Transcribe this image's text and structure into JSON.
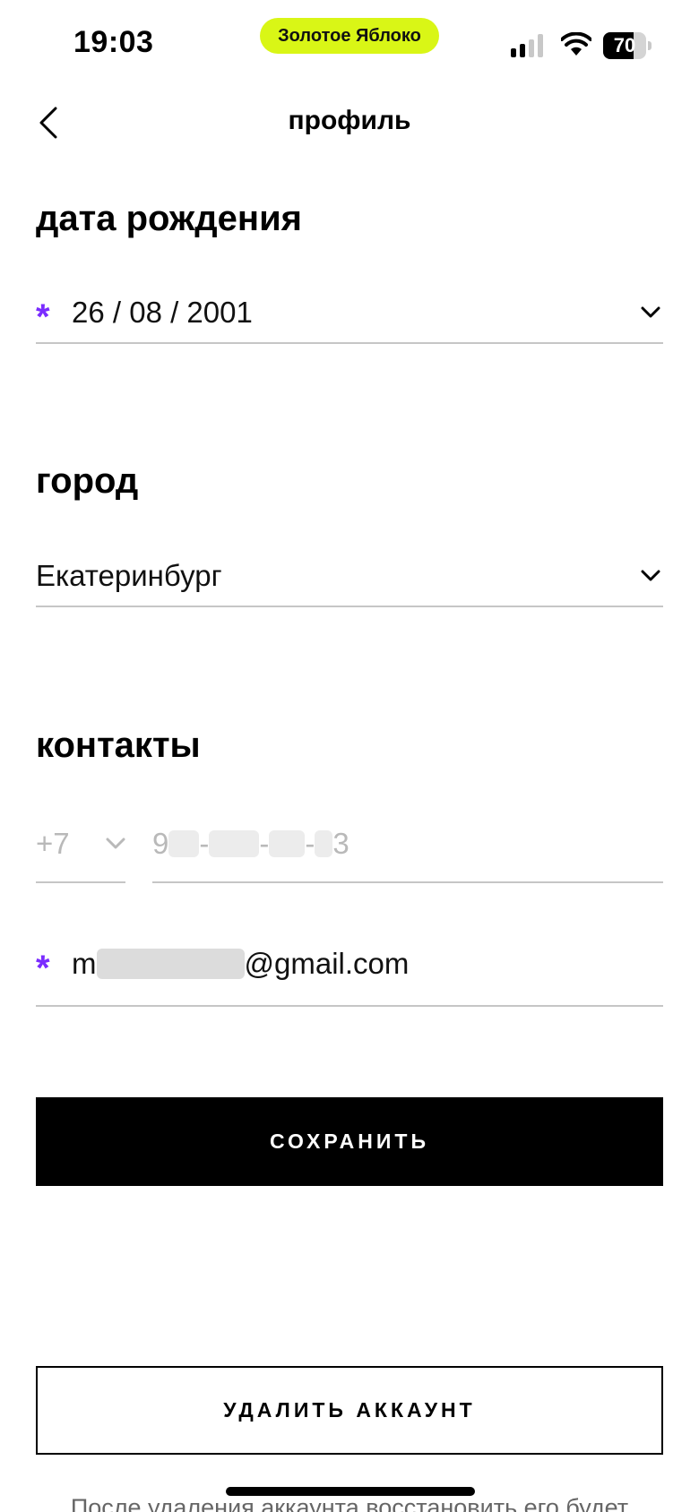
{
  "status_bar": {
    "time": "19:03",
    "app_label": "Золотое Яблоко",
    "battery_level": "70",
    "battery_fraction": 0.7,
    "signal_bars_active": 2,
    "signal_bars_total": 4
  },
  "header": {
    "title": "профиль",
    "back_icon": "chevron-left-icon"
  },
  "birth_date": {
    "title": "дата рождения",
    "required_mark": "*",
    "value": "26 / 08 / 2001"
  },
  "city": {
    "title": "город",
    "value": "Екатеринбург"
  },
  "contacts": {
    "title": "контакты",
    "phone_code": "+7",
    "phone_parts": [
      "9",
      "-",
      "-",
      "-",
      "3"
    ],
    "email_required_mark": "*",
    "email_prefix": "m",
    "email_domain": "@gmail.com"
  },
  "actions": {
    "save_label": "СОХРАНИТЬ",
    "delete_label": "УДАЛИТЬ АККАУНТ"
  },
  "footnote": "После удаления аккаунта восстановить его будет",
  "colors": {
    "accent_purple": "#7a2cff",
    "app_pill": "#d9f616",
    "divider": "#c6c6c6"
  }
}
